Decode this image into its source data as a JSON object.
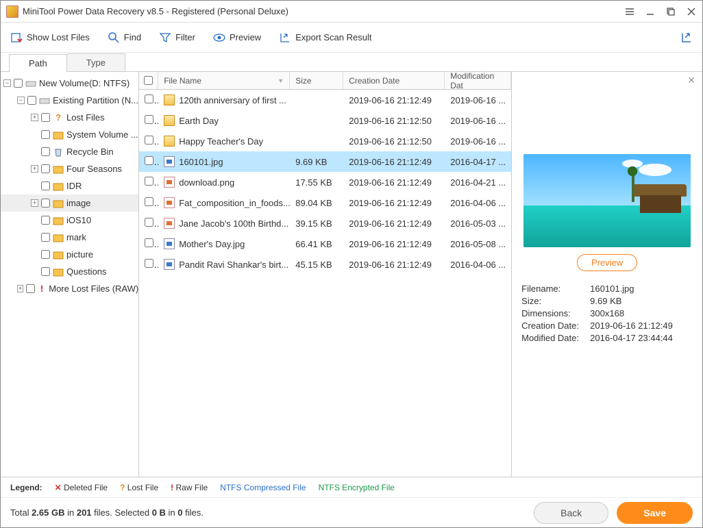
{
  "title": "MiniTool Power Data Recovery v8.5 - Registered (Personal Deluxe)",
  "toolbar": {
    "show_lost": "Show Lost Files",
    "find": "Find",
    "filter": "Filter",
    "preview": "Preview",
    "export": "Export Scan Result"
  },
  "tabs": {
    "path": "Path",
    "type": "Type"
  },
  "tree": {
    "root": "New Volume(D: NTFS)",
    "existing": "Existing Partition (N...",
    "lost_files": "Lost Files",
    "sys_vol": "System Volume ...",
    "recycle": "Recycle Bin",
    "four_seasons": "Four Seasons",
    "idr": "IDR",
    "image": "image",
    "ios10": "iOS10",
    "mark": "mark",
    "picture": "picture",
    "questions": "Questions",
    "more_lost": "More Lost Files (RAW)"
  },
  "headers": {
    "name": "File Name",
    "size": "Size",
    "cd": "Creation Date",
    "md": "Modification Dat"
  },
  "files": [
    {
      "name": "120th anniversary of first ...",
      "size": "",
      "cd": "2019-06-16 21:12:49",
      "md": "2019-06-16 ...",
      "icon": "fold"
    },
    {
      "name": "Earth Day",
      "size": "",
      "cd": "2019-06-16 21:12:50",
      "md": "2019-06-16 ...",
      "icon": "fold"
    },
    {
      "name": "Happy Teacher's Day",
      "size": "",
      "cd": "2019-06-16 21:12:50",
      "md": "2019-06-16 ...",
      "icon": "fold"
    },
    {
      "name": "160101.jpg",
      "size": "9.69 KB",
      "cd": "2019-06-16 21:12:49",
      "md": "2016-04-17 ...",
      "icon": "jpg"
    },
    {
      "name": "download.png",
      "size": "17.55 KB",
      "cd": "2019-06-16 21:12:49",
      "md": "2016-04-21 ...",
      "icon": "png"
    },
    {
      "name": "Fat_composition_in_foods...",
      "size": "89.04 KB",
      "cd": "2019-06-16 21:12:49",
      "md": "2016-04-06 ...",
      "icon": "png"
    },
    {
      "name": "Jane Jacob's 100th Birthd...",
      "size": "39.15 KB",
      "cd": "2019-06-16 21:12:49",
      "md": "2016-05-03 ...",
      "icon": "png"
    },
    {
      "name": "Mother's Day.jpg",
      "size": "66.41 KB",
      "cd": "2019-06-16 21:12:49",
      "md": "2016-05-08 ...",
      "icon": "jpg"
    },
    {
      "name": "Pandit Ravi Shankar's birt...",
      "size": "45.15 KB",
      "cd": "2019-06-16 21:12:49",
      "md": "2016-04-06 ...",
      "icon": "jpg"
    }
  ],
  "preview": {
    "button": "Preview",
    "labels": {
      "fn": "Filename:",
      "sz": "Size:",
      "dim": "Dimensions:",
      "cd": "Creation Date:",
      "md": "Modified Date:"
    },
    "filename": "160101.jpg",
    "size": "9.69 KB",
    "dimensions": "300x168",
    "creation": "2019-06-16 21:12:49",
    "modified": "2016-04-17 23:44:44"
  },
  "legend": {
    "label": "Legend:",
    "deleted": "Deleted File",
    "lost": "Lost File",
    "raw": "Raw File",
    "ntfs_c": "NTFS Compressed File",
    "ntfs_e": "NTFS Encrypted File"
  },
  "footer": {
    "stat_pre": "Total ",
    "total_size": "2.65 GB",
    "stat_mid1": " in ",
    "total_files": "201",
    "stat_mid2": " files.  Selected ",
    "sel_size": "0 B",
    "stat_mid3": " in ",
    "sel_files": "0",
    "stat_post": " files.",
    "back": "Back",
    "save": "Save"
  }
}
